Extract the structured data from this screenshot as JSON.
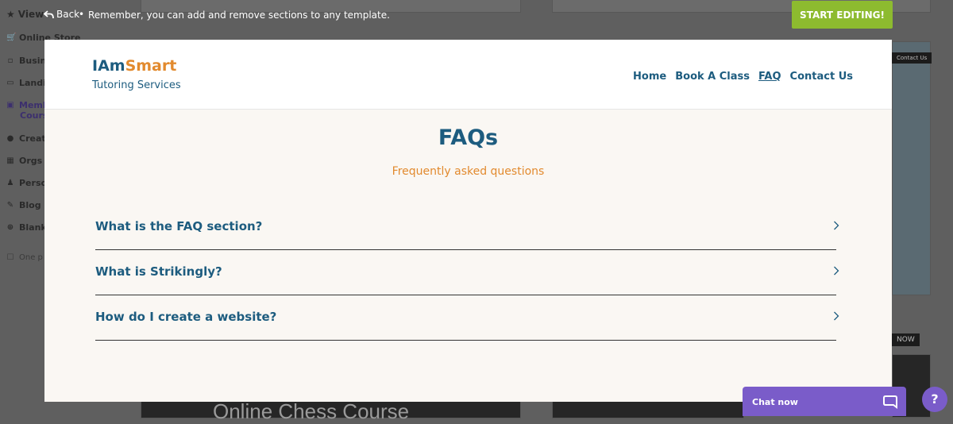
{
  "topbar": {
    "view_label": "View",
    "back_label": "Back",
    "separator": "•",
    "hint": "Remember, you can add and remove sections to any template.",
    "start_label": "START EDITING!"
  },
  "bg_sidebar": {
    "online_store": "Online Store",
    "business": "Busin",
    "landing": "Landi",
    "membership_1": "Memb",
    "membership_2": "Cours",
    "creative": "Creat",
    "orgs": "Orgs",
    "personal": "Perso",
    "blog": "Blog",
    "blank": "Blank",
    "one_page": "One p"
  },
  "bg_cards": {
    "chess": "Online Chess Course",
    "contact": "Contact Us",
    "now": "NOW"
  },
  "site": {
    "logo_part1": "IAm",
    "logo_part2": "Smart",
    "tagline": "Tutoring Services",
    "nav": [
      "Home",
      "Book A Class",
      "FAQ",
      "Contact Us"
    ],
    "active_nav": "FAQ"
  },
  "faq": {
    "title": "FAQs",
    "subtitle": "Frequently asked questions",
    "items": [
      {
        "question": "What is the FAQ section?"
      },
      {
        "question": "What is Strikingly?"
      },
      {
        "question": "How do I create a website?"
      }
    ]
  },
  "chat": {
    "label": "Chat now"
  },
  "help": {
    "label": "?"
  },
  "colors": {
    "brand_blue": "#1d5c7f",
    "brand_orange": "#e28a2e",
    "start_green": "#8dbb2f",
    "chat_purple": "#7a5cc9"
  }
}
